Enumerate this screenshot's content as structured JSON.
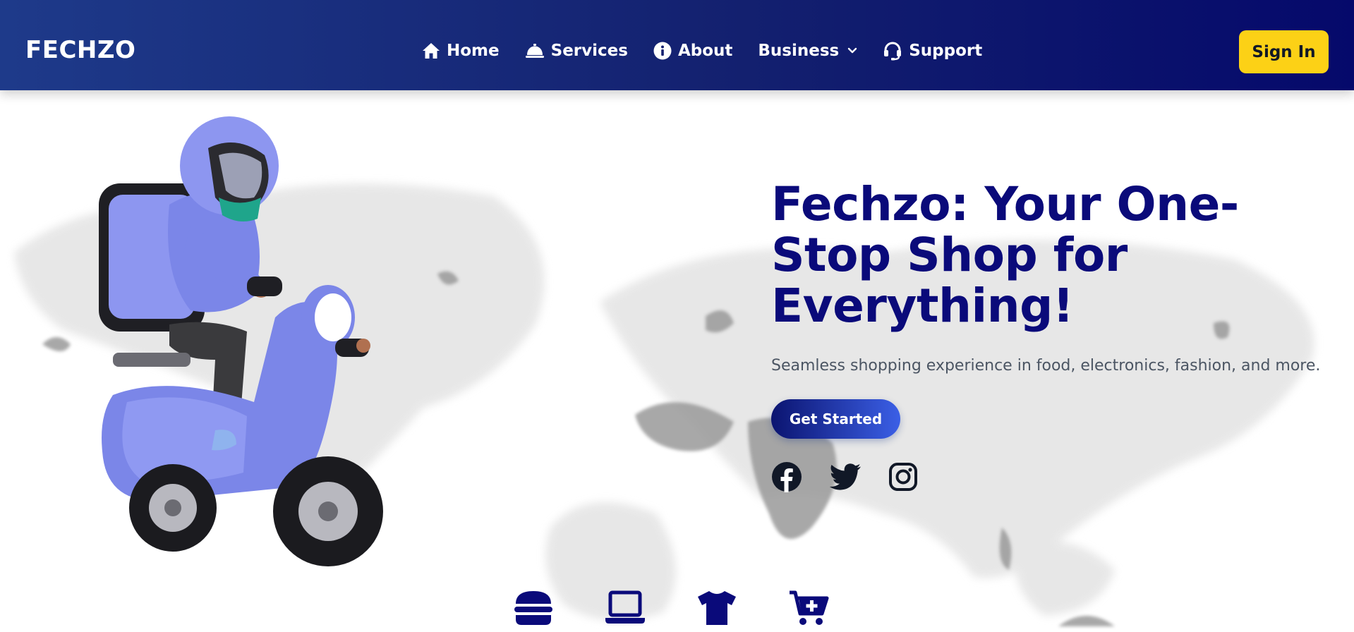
{
  "header": {
    "brand": "FECHZO",
    "nav": [
      {
        "label": "Home",
        "icon": "home-icon"
      },
      {
        "label": "Services",
        "icon": "bell-icon"
      },
      {
        "label": "About",
        "icon": "info-circle-icon"
      },
      {
        "label": "Business",
        "icon": "chevron-down-icon"
      },
      {
        "label": "Support",
        "icon": "headset-icon"
      }
    ],
    "signin_label": "Sign In"
  },
  "hero": {
    "title_lines": [
      "Fechzo: Your One-",
      "Stop Shop for",
      "Everything!"
    ],
    "subtitle": "Seamless shopping experience in food, electronics, fashion, and more.",
    "cta_label": "Get Started",
    "illustration": "delivery-rider-on-scooter",
    "socials": [
      "facebook-icon",
      "twitter-icon",
      "instagram-icon"
    ]
  },
  "categories": [
    "burger-icon",
    "laptop-icon",
    "tshirt-icon",
    "cart-plus-icon"
  ],
  "colors": {
    "header_gradient_start": "#1e3a8a",
    "header_gradient_end": "#05096b",
    "signin_bg": "#fcd116",
    "title_color": "#0a0a7a",
    "scooter_color": "#7b86e8",
    "social_color": "#111827"
  }
}
